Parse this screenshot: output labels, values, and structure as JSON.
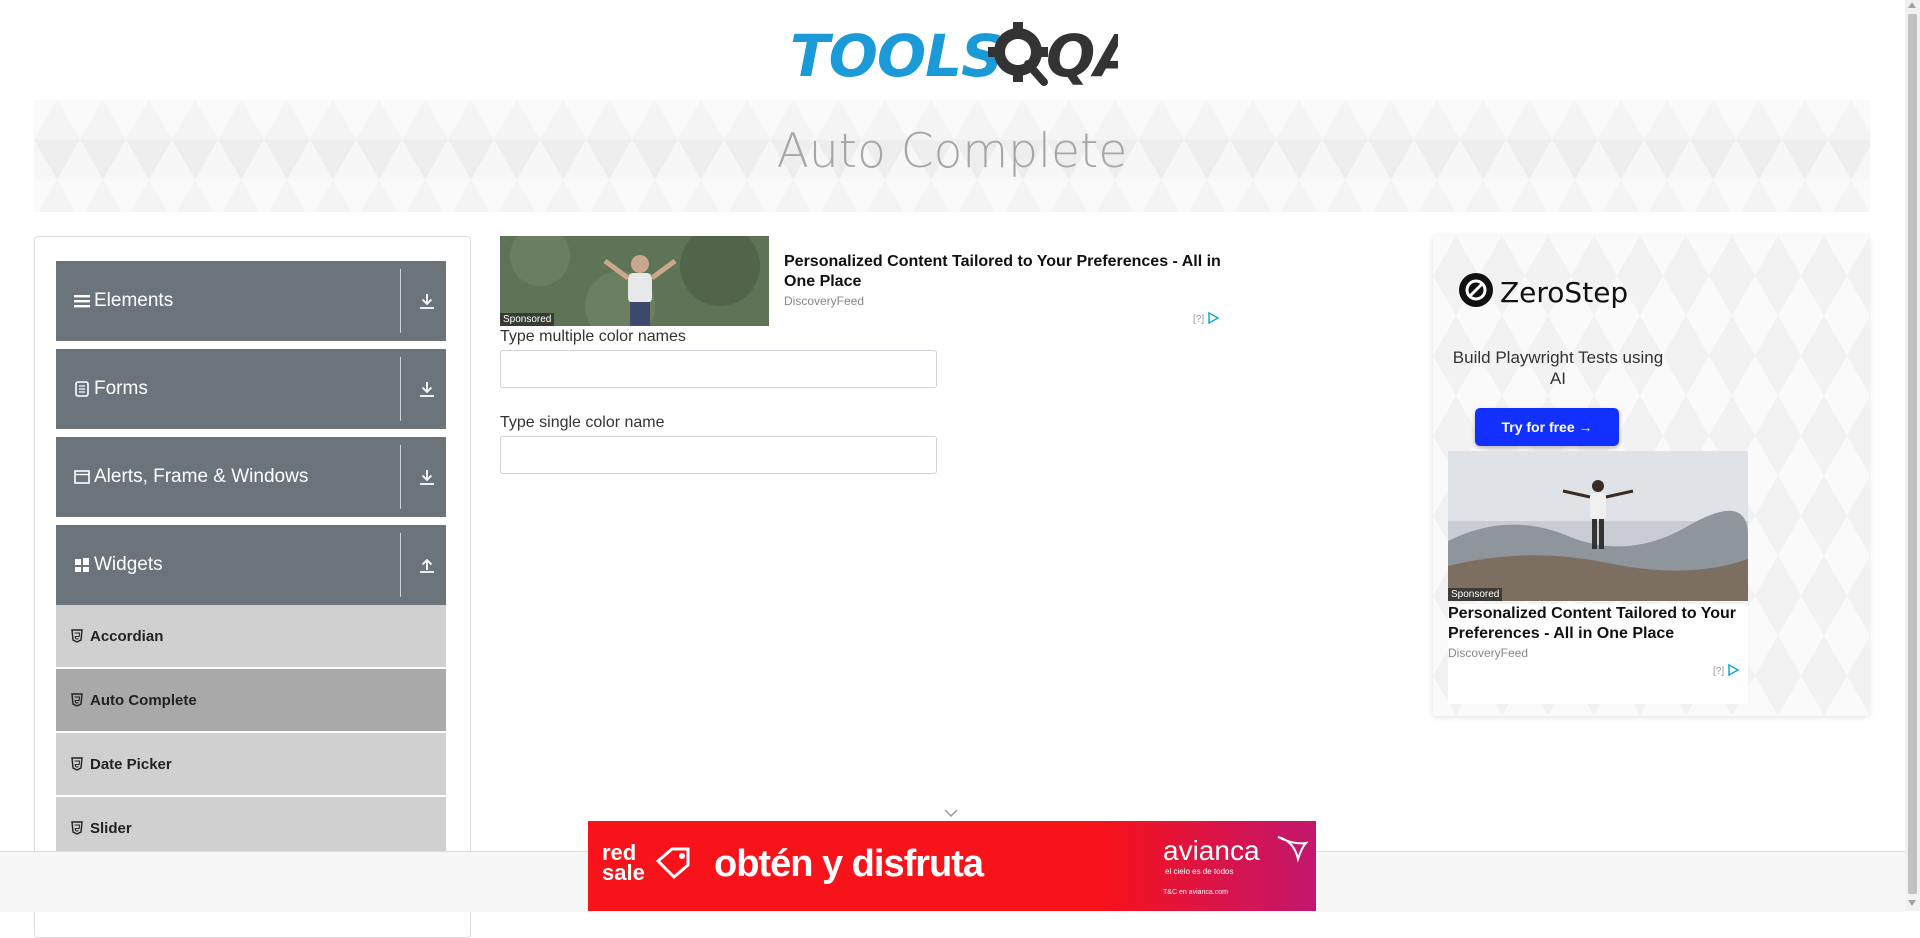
{
  "header": {
    "logo_text_primary": "TOOLS",
    "logo_text_secondary": "QA"
  },
  "banner": {
    "title": "Auto Complete"
  },
  "sidebar": {
    "groups": [
      {
        "label": "Elements",
        "icon": "hamburger-icon",
        "state": "collapsed"
      },
      {
        "label": "Forms",
        "icon": "document-icon",
        "state": "collapsed"
      },
      {
        "label": "Alerts, Frame & Windows",
        "icon": "window-icon",
        "state": "collapsed"
      },
      {
        "label": "Widgets",
        "icon": "widgets-icon",
        "state": "expanded"
      }
    ],
    "items": [
      {
        "label": "Accordian",
        "active": false
      },
      {
        "label": "Auto Complete",
        "active": true
      },
      {
        "label": "Date Picker",
        "active": false
      },
      {
        "label": "Slider",
        "active": false
      }
    ]
  },
  "ad_top": {
    "sponsored": "Sponsored",
    "title": "Personalized Content Tailored to Your Preferences - All in One Place",
    "source": "DiscoveryFeed",
    "adchoice": "[?]"
  },
  "form": {
    "multiple_label": "Type multiple color names",
    "multiple_value": "",
    "single_label": "Type single color name",
    "single_value": ""
  },
  "ad_right": {
    "brand": "ZeroStep",
    "tagline": "Build Playwright Tests using AI",
    "button": "Try for free →",
    "sponsored": "Sponsored",
    "title": "Personalized Content Tailored to Your Preferences - All in One Place",
    "source": "DiscoveryFeed",
    "adchoice": "[?]"
  },
  "ad_bottom": {
    "left_line1": "red",
    "left_line2": "sale",
    "headline": "obtén y disfruta",
    "brand": "avianca",
    "brand_tag": "el cielo es de todos",
    "fine_print": "T&C en avianca.com"
  },
  "colors": {
    "logo_blue": "#1a9bd7",
    "logo_dark": "#333333",
    "sidebar_header": "#6b737b",
    "menu_item": "#d0d0d0",
    "menu_item_active": "#a9a9a9",
    "zerostep_button": "#1230ff",
    "bottom_ad_red": "#f8121a"
  }
}
